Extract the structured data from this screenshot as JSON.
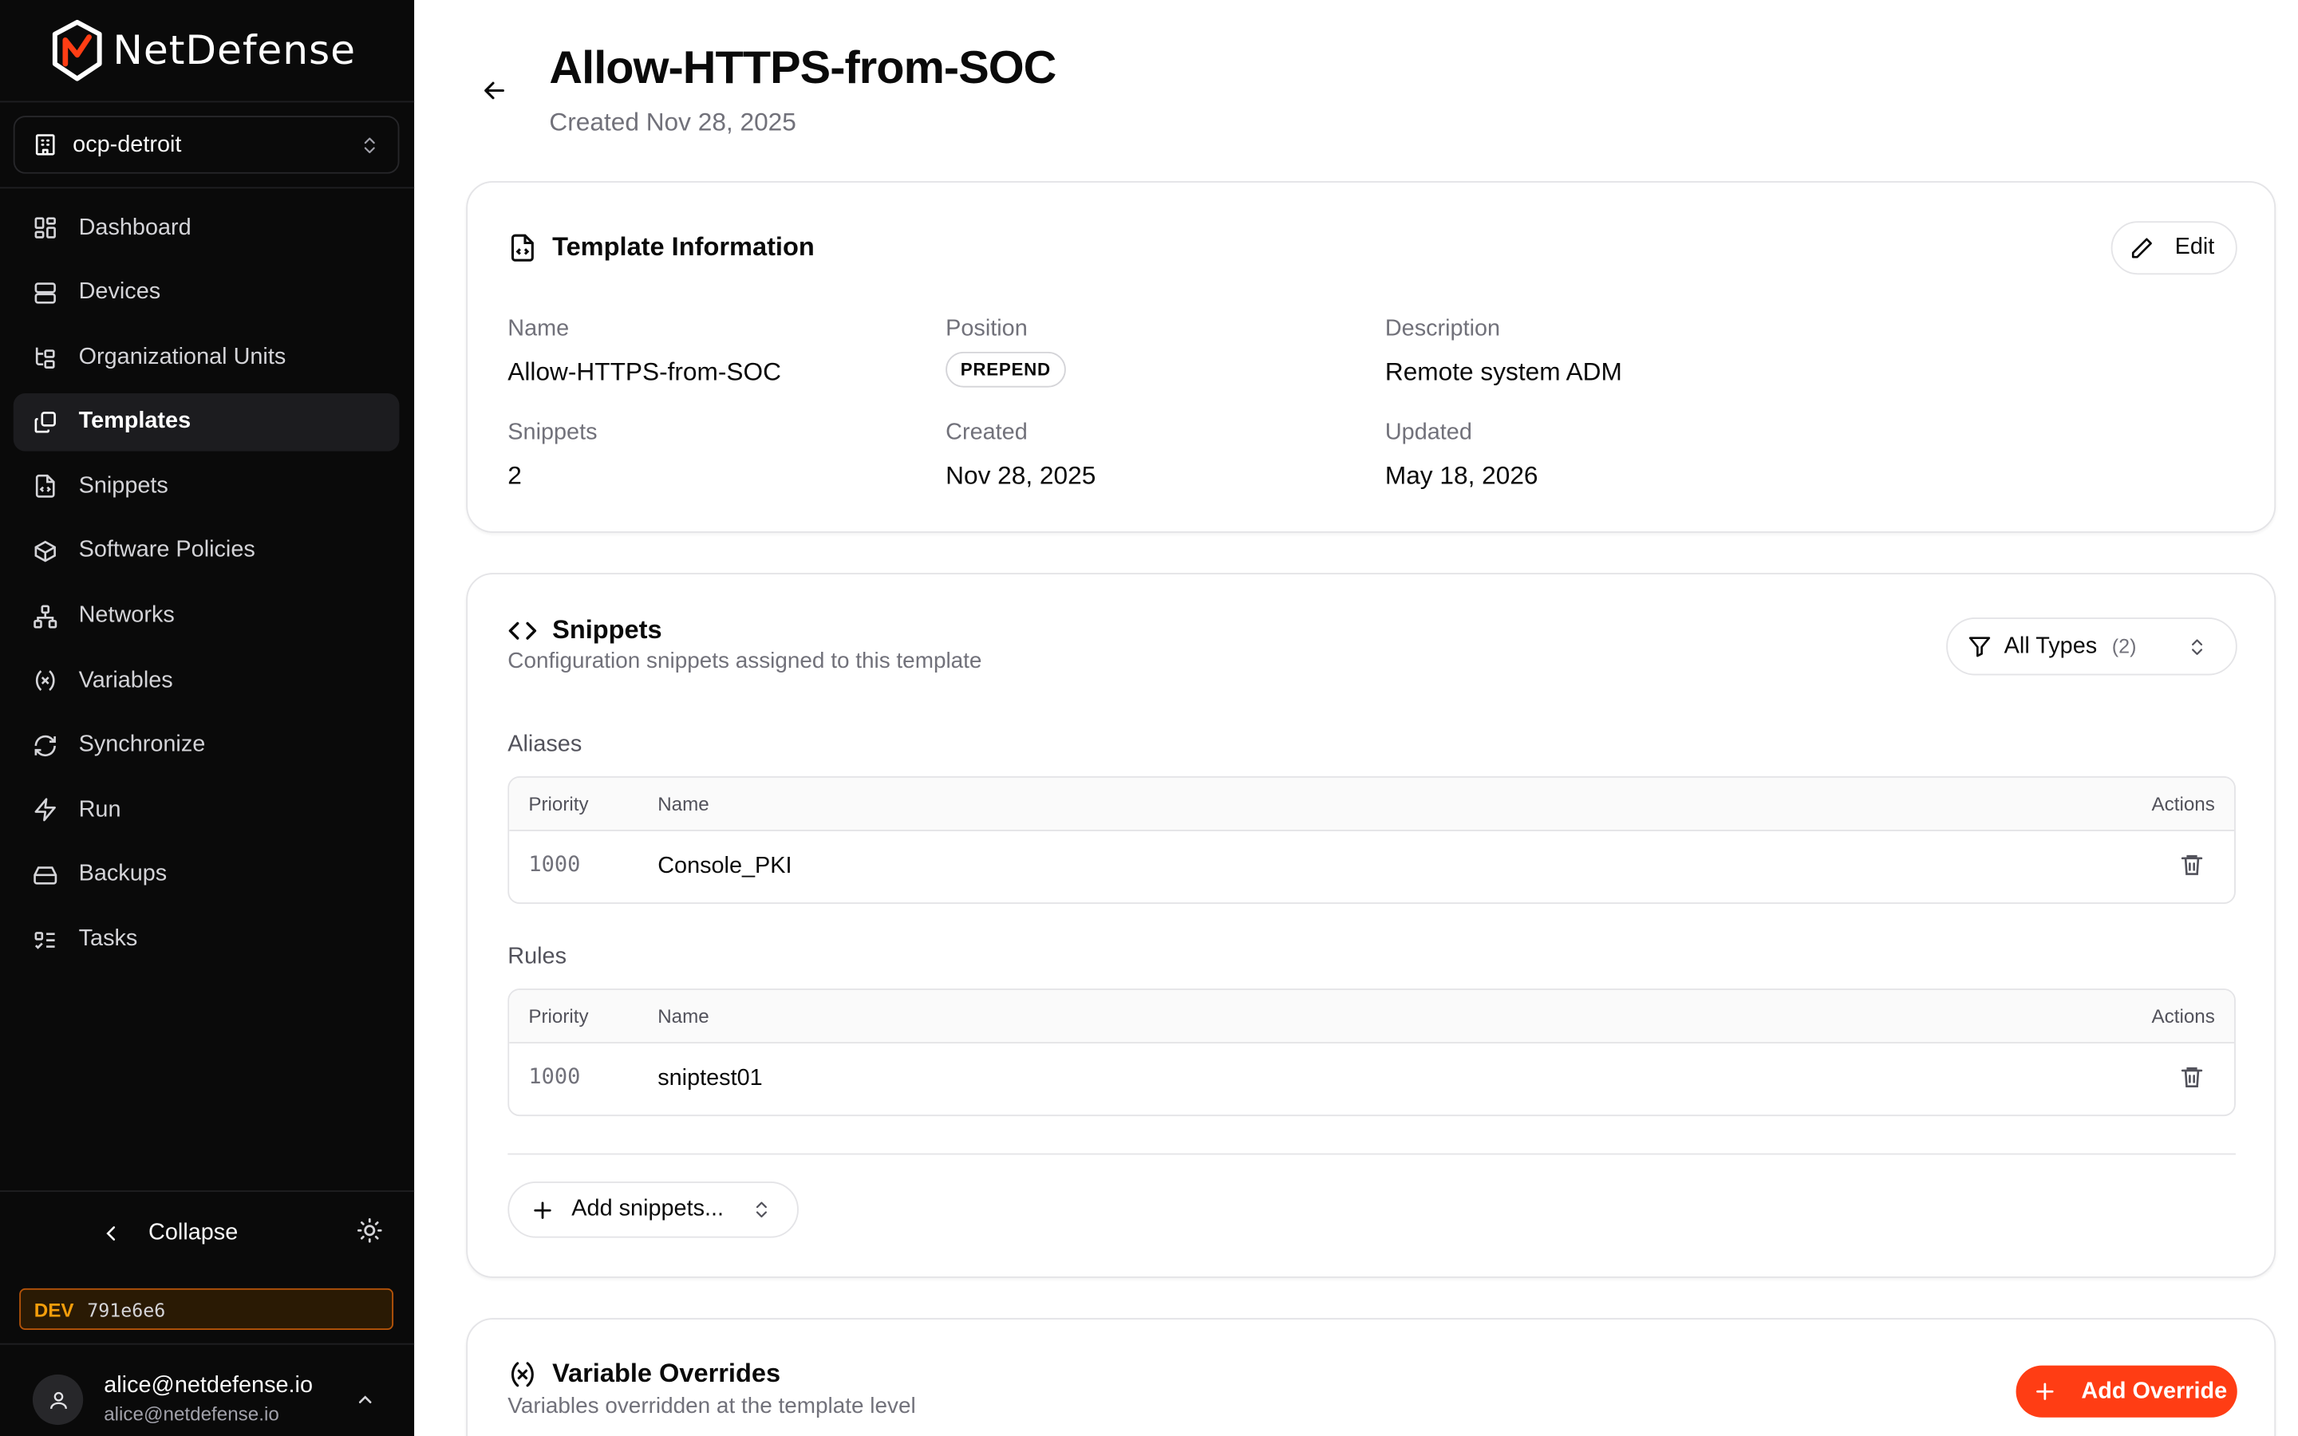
{
  "app": {
    "name": "NetDefense"
  },
  "org": {
    "label": "ocp-detroit"
  },
  "nav": [
    {
      "label": "Dashboard",
      "icon": "dashboard-icon",
      "active": false
    },
    {
      "label": "Devices",
      "icon": "server-icon",
      "active": false
    },
    {
      "label": "Organizational Units",
      "icon": "tree-icon",
      "active": false
    },
    {
      "label": "Templates",
      "icon": "copy-icon",
      "active": true
    },
    {
      "label": "Snippets",
      "icon": "file-code-icon",
      "active": false
    },
    {
      "label": "Software Policies",
      "icon": "package-icon",
      "active": false
    },
    {
      "label": "Networks",
      "icon": "network-icon",
      "active": false
    },
    {
      "label": "Variables",
      "icon": "variable-icon",
      "active": false
    },
    {
      "label": "Synchronize",
      "icon": "refresh-icon",
      "active": false
    },
    {
      "label": "Run",
      "icon": "zap-icon",
      "active": false
    },
    {
      "label": "Backups",
      "icon": "hard-drive-icon",
      "active": false
    },
    {
      "label": "Tasks",
      "icon": "list-todo-icon",
      "active": false
    }
  ],
  "sidebar_footer": {
    "collapse_label": "Collapse",
    "env_tag": "DEV",
    "env_hash": "791e6e6",
    "user_name": "alice@netdefense.io",
    "user_email": "alice@netdefense.io"
  },
  "page": {
    "title": "Allow-HTTPS-from-SOC",
    "subtitle": "Created Nov 28, 2025"
  },
  "template_info": {
    "title": "Template Information",
    "edit_label": "Edit",
    "name_label": "Name",
    "name_value": "Allow-HTTPS-from-SOC",
    "position_label": "Position",
    "position_value": "PREPEND",
    "description_label": "Description",
    "description_value": "Remote system ADM",
    "snippets_label": "Snippets",
    "snippets_value": "2",
    "created_label": "Created",
    "created_value": "Nov 28, 2025",
    "updated_label": "Updated",
    "updated_value": "May 18, 2026"
  },
  "snippets": {
    "title": "Snippets",
    "description": "Configuration snippets assigned to this template",
    "filter_label": "All Types",
    "filter_count": "(2)",
    "add_label": "Add snippets...",
    "columns": {
      "priority": "Priority",
      "name": "Name",
      "actions": "Actions"
    },
    "groups": [
      {
        "label": "Aliases",
        "rows": [
          {
            "priority": "1000",
            "name": "Console_PKI"
          }
        ]
      },
      {
        "label": "Rules",
        "rows": [
          {
            "priority": "1000",
            "name": "sniptest01"
          }
        ]
      }
    ]
  },
  "overrides": {
    "title": "Variable Overrides",
    "description": "Variables overridden at the template level",
    "add_label": "Add Override"
  },
  "colors": {
    "brand": "#ff3d14",
    "sidebar_bg": "#0a0a0a",
    "dev_accent": "#f59e0b"
  }
}
